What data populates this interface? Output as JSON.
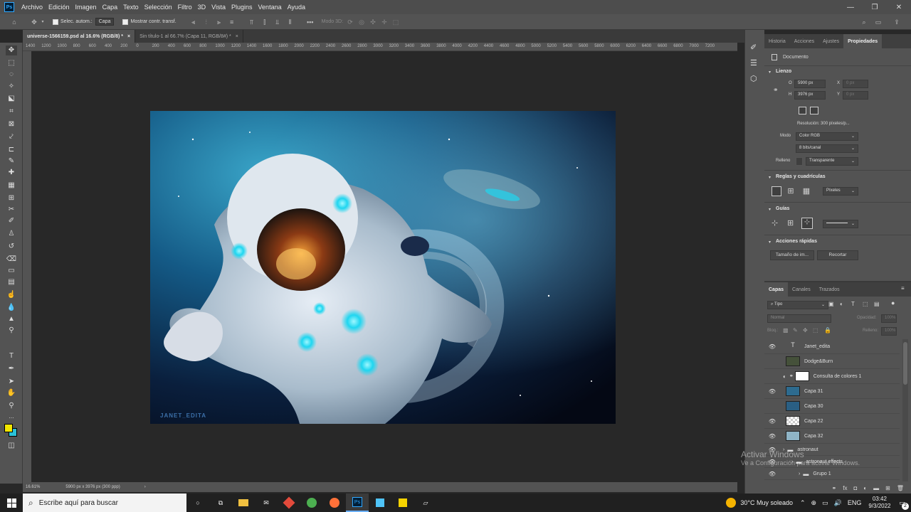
{
  "menu": {
    "logo": "Ps",
    "items": [
      "Archivo",
      "Edición",
      "Imagen",
      "Capa",
      "Texto",
      "Selección",
      "Filtro",
      "3D",
      "Vista",
      "Plugins",
      "Ventana",
      "Ayuda"
    ]
  },
  "options": {
    "auto_select_label": "Selec. autom.:",
    "auto_select_value": "Capa",
    "show_transform_label": "Mostrar contr. transf.",
    "mode3d_label": "Modo 3D:"
  },
  "tabs": [
    {
      "label": "universe-1566159.psd al 16.6% (RGB/8) *",
      "active": true
    },
    {
      "label": "Sin título-1 al 66.7% (Capa 11, RGB/8#) *",
      "active": false
    }
  ],
  "ruler_ticks": [
    "1400",
    "1200",
    "1000",
    "800",
    "600",
    "400",
    "200",
    "0",
    "200",
    "400",
    "600",
    "800",
    "1000",
    "1200",
    "1400",
    "1600",
    "1800",
    "2000",
    "2200",
    "2400",
    "2600",
    "2800",
    "3000",
    "3200",
    "3400",
    "3600",
    "3800",
    "4000",
    "4200",
    "4400",
    "4600",
    "4800",
    "5000",
    "5200",
    "5400",
    "5600",
    "5800",
    "6000",
    "6200",
    "6400",
    "6600",
    "6800",
    "7000",
    "7200"
  ],
  "canvas": {
    "signature": "JANET_EDITA"
  },
  "status": {
    "zoom": "16.61%",
    "doc_size": "5900 px x 3976 px (300 ppp)"
  },
  "properties_panel": {
    "tabs": [
      "Historia",
      "Acciones",
      "Ajustes",
      "Propiedades"
    ],
    "doc_label": "Documento",
    "canvas_section": "Lienzo",
    "width_label": "O",
    "width_value": "5900 px",
    "height_label": "H",
    "height_value": "3976 px",
    "x_label": "X",
    "x_placeholder": "0 px",
    "y_label": "Y",
    "y_placeholder": "0 px",
    "resolution": "Resolución: 300 píxeles/p...",
    "mode_label": "Modo",
    "mode_value": "Color RGB",
    "bits_value": "8 bits/canal",
    "fill_label": "Relleno",
    "fill_value": "Transparente",
    "rulers_section": "Reglas y cuadrículas",
    "units_value": "Píxeles",
    "guides_section": "Guías",
    "quick_actions_section": "Acciones rápidas",
    "image_size_button": "Tamaño de im...",
    "crop_button": "Recortar"
  },
  "layers_panel": {
    "tabs": [
      "Capas",
      "Canales",
      "Trazados"
    ],
    "filter_kind": "Tipo",
    "blend_mode": "Normal",
    "opacity_label": "Opacidad:",
    "opacity_value": "100%",
    "lock_label": "Bloq.:",
    "fill_label": "Relleno:",
    "fill_value": "100%",
    "layers": [
      {
        "name": "Janet_edita",
        "visible": true,
        "kind": "text"
      },
      {
        "name": "Dodge&Burn",
        "visible": false,
        "kind": "image"
      },
      {
        "name": "Consulta de colores 1",
        "visible": false,
        "kind": "adjustment"
      },
      {
        "name": "Capa 31",
        "visible": true,
        "kind": "image"
      },
      {
        "name": "Capa 30",
        "visible": false,
        "kind": "image"
      },
      {
        "name": "Capa 22",
        "visible": true,
        "kind": "image"
      },
      {
        "name": "Capa 32",
        "visible": true,
        "kind": "image"
      },
      {
        "name": "astronaut",
        "visible": true,
        "kind": "group"
      },
      {
        "name": "astronaut effects",
        "visible": true,
        "kind": "group"
      },
      {
        "name": "Grupo 1",
        "visible": true,
        "kind": "group"
      }
    ]
  },
  "watermark": {
    "title": "Activar Windows",
    "subtitle": "Ve a Configuración para activar Windows."
  },
  "taskbar": {
    "search_placeholder": "Escribe aquí para buscar",
    "weather": "30°C  Muy soleado",
    "language": "ENG",
    "time": "03:42",
    "date": "9/3/2022",
    "notifications": "2"
  }
}
